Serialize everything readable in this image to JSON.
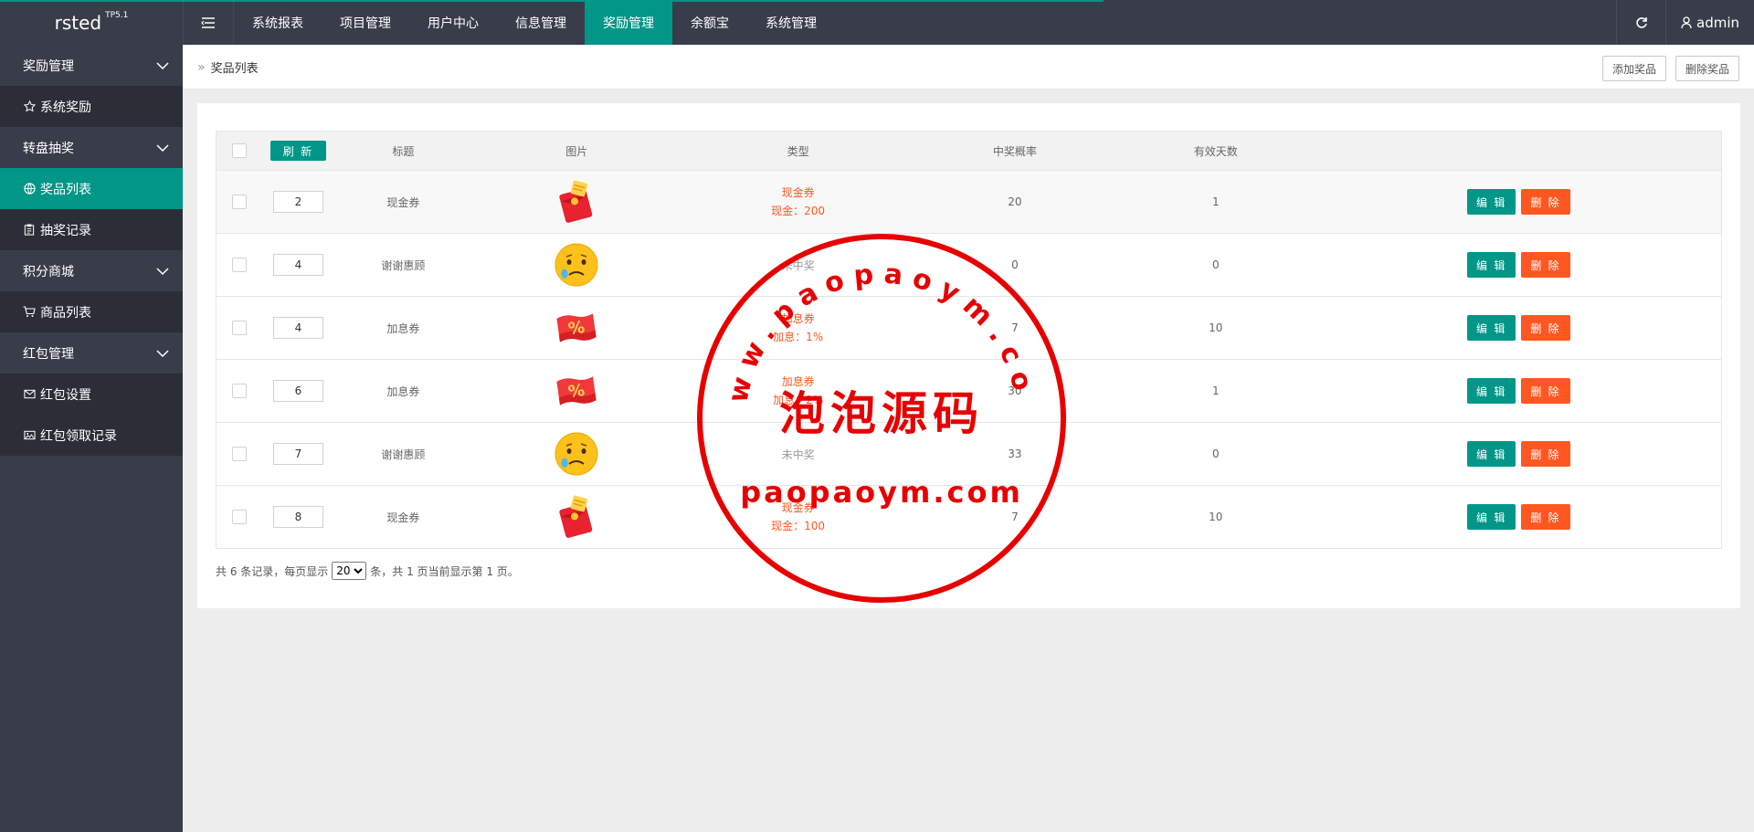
{
  "header": {
    "logo": "rsted",
    "logo_sup": "TP5.1",
    "nav": [
      "系统报表",
      "项目管理",
      "用户中心",
      "信息管理",
      "奖励管理",
      "余额宝",
      "系统管理"
    ],
    "active_nav_index": 4,
    "user": "admin"
  },
  "sidebar": {
    "groups": [
      {
        "label": "奖励管理",
        "items": [
          {
            "label": "系统奖励",
            "icon": "star-icon"
          }
        ]
      },
      {
        "label": "转盘抽奖",
        "items": [
          {
            "label": "奖品列表",
            "icon": "globe-icon"
          },
          {
            "label": "抽奖记录",
            "icon": "clipboard-icon"
          }
        ]
      },
      {
        "label": "积分商城",
        "items": [
          {
            "label": "商品列表",
            "icon": "cart-icon"
          }
        ]
      },
      {
        "label": "红包管理",
        "items": [
          {
            "label": "红包设置",
            "icon": "envelope-icon"
          },
          {
            "label": "红包领取记录",
            "icon": "image-icon"
          }
        ]
      }
    ],
    "active_item": "奖品列表"
  },
  "breadcrumb": {
    "current": "奖品列表",
    "add_button": "添加奖品",
    "delete_button": "删除奖品"
  },
  "table": {
    "refresh_label": "刷 新",
    "headers": [
      "标题",
      "图片",
      "类型",
      "中奖概率",
      "有效天数"
    ],
    "edit_label": "编 辑",
    "delete_label": "删 除",
    "rows": [
      {
        "sort": "2",
        "title": "现金券",
        "image": "red-envelope",
        "type": "现金券",
        "type_detail": "现金：200",
        "probability": "20",
        "days": "1"
      },
      {
        "sort": "4",
        "title": "谢谢惠顾",
        "image": "sad-face",
        "type": "未中奖",
        "type_detail": "",
        "probability": "0",
        "days": "0"
      },
      {
        "sort": "4",
        "title": "加息券",
        "image": "percent-coupon",
        "type": "加息券",
        "type_detail": "加息：1%",
        "probability": "7",
        "days": "10"
      },
      {
        "sort": "6",
        "title": "加息券",
        "image": "percent-coupon",
        "type": "加息券",
        "type_detail": "加息：2%",
        "probability": "30",
        "days": "1"
      },
      {
        "sort": "7",
        "title": "谢谢惠顾",
        "image": "sad-face",
        "type": "未中奖",
        "type_detail": "",
        "probability": "33",
        "days": "0"
      },
      {
        "sort": "8",
        "title": "现金券",
        "image": "red-envelope",
        "type": "现金券",
        "type_detail": "现金：100",
        "probability": "7",
        "days": "10"
      }
    ]
  },
  "pager": {
    "prefix": "共 6 条记录，每页显示",
    "page_size": "20",
    "suffix": "条，共 1 页当前显示第 1 页。"
  },
  "watermark": {
    "top_text": "www.paopaoym.com",
    "middle_text": "泡泡源码",
    "bottom_text": "paopaoym.com"
  },
  "colors": {
    "header_bg": "#393d49",
    "accent": "#009688",
    "danger": "#ff5722",
    "stamp": "#e60000"
  }
}
